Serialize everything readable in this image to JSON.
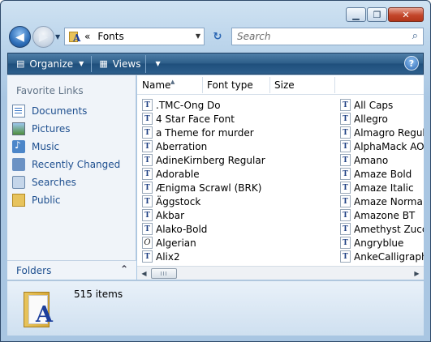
{
  "window": {
    "caption": {
      "minimize": "▁",
      "maximize": "❐",
      "close": "✕"
    }
  },
  "nav": {
    "back": "◀",
    "forward": "▶",
    "history": "▼"
  },
  "address": {
    "chevron": "«",
    "location": "Fonts",
    "dropdown": "▼"
  },
  "refresh": "↻",
  "search": {
    "placeholder": "Search",
    "icon": "⌕"
  },
  "toolbar": {
    "organize_label": "Organize",
    "views_label": "Views",
    "organize_arrow": "▼",
    "views_arrow": "▼",
    "help": "?"
  },
  "sidebar": {
    "heading": "Favorite Links",
    "items": [
      {
        "label": "Documents",
        "icon": "documents-icon"
      },
      {
        "label": "Pictures",
        "icon": "pictures-icon"
      },
      {
        "label": "Music",
        "icon": "music-icon"
      },
      {
        "label": "Recently Changed",
        "icon": "recently-changed-icon"
      },
      {
        "label": "Searches",
        "icon": "searches-icon"
      },
      {
        "label": "Public",
        "icon": "public-icon"
      }
    ],
    "folders_label": "Folders",
    "folders_chevron": "⌃"
  },
  "columns": {
    "name": "Name",
    "type": "Font type",
    "size": "Size",
    "sort_glyph": "▲"
  },
  "files": {
    "col1": [
      {
        "name": ".TMC-Ong Do",
        "icon": "TT"
      },
      {
        "name": "4 Star Face Font",
        "icon": "TT"
      },
      {
        "name": "a Theme for murder",
        "icon": "TT"
      },
      {
        "name": "Aberration",
        "icon": "TT"
      },
      {
        "name": "AdineKirnberg Regular",
        "icon": "TT"
      },
      {
        "name": "Adorable",
        "icon": "TT"
      },
      {
        "name": "Ænigma Scrawl (BRK)",
        "icon": "TT"
      },
      {
        "name": "Äggstock",
        "icon": "TT"
      },
      {
        "name": "Akbar",
        "icon": "TT"
      },
      {
        "name": "Alako-Bold",
        "icon": "TT"
      },
      {
        "name": "Algerian",
        "icon": "O"
      },
      {
        "name": "Alix2",
        "icon": "TT"
      }
    ],
    "col2": [
      {
        "name": "All Caps",
        "icon": "TT"
      },
      {
        "name": "Allegro",
        "icon": "TT"
      },
      {
        "name": "Almagro Regular",
        "icon": "TT"
      },
      {
        "name": "AlphaMack AOE",
        "icon": "TT"
      },
      {
        "name": "Amano",
        "icon": "TT"
      },
      {
        "name": "Amaze Bold",
        "icon": "TT"
      },
      {
        "name": "Amaze Italic",
        "icon": "TT"
      },
      {
        "name": "Amaze Normal",
        "icon": "TT"
      },
      {
        "name": "Amazone BT",
        "icon": "TT"
      },
      {
        "name": "Amethyst Zucchi",
        "icon": "TT"
      },
      {
        "name": "Angryblue",
        "icon": "TT"
      },
      {
        "name": "AnkeCalligraph",
        "icon": "TT"
      }
    ]
  },
  "scrollbar": {
    "left": "◀",
    "right": "▶"
  },
  "details": {
    "count": "515 items",
    "folder_glyph": "A"
  }
}
